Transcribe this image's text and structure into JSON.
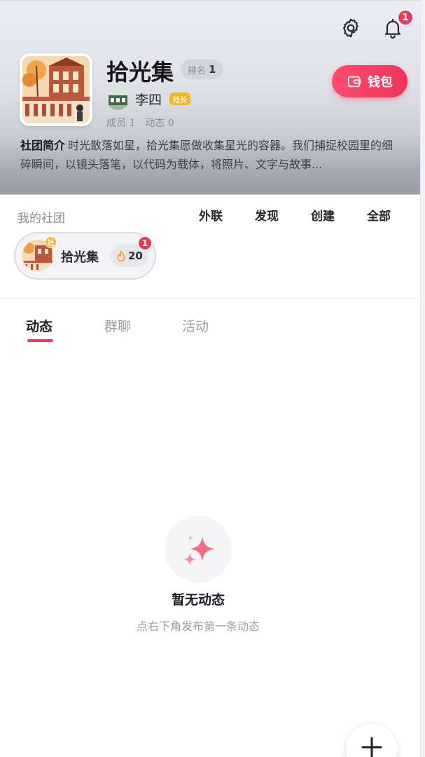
{
  "header": {
    "notification_count": "1",
    "club_name": "拾光集",
    "rank_label": "排名",
    "rank_value": "1",
    "owner_name": "李四",
    "owner_role": "社长",
    "members_label": "成员 1",
    "posts_label": "动态 0",
    "wallet_label": "钱包",
    "intro_label": "社团简介",
    "intro_text": "时光散落如星，拾光集愿做收集星光的容器。我们捕捉校园里的细碎瞬间，以镜头落笔，以代码为载体，将照片、文字与故事..."
  },
  "my_clubs": {
    "title": "我的社团",
    "nav": [
      "外联",
      "发现",
      "创建",
      "全部"
    ],
    "items": [
      {
        "avatar_badge": "社",
        "name": "拾光集",
        "heat": "20",
        "unread": "1"
      }
    ]
  },
  "tabs": [
    "动态",
    "群聊",
    "活动"
  ],
  "active_tab": "动态",
  "empty_state": {
    "title": "暂无动态",
    "subtitle": "点右下角发布第一条动态"
  },
  "colors": {
    "accent": "#f0395a",
    "role_badge": "#f6b626",
    "muted_text": "#9b9da5"
  },
  "icons": [
    "gear-icon",
    "bell-icon",
    "wallet-icon",
    "flame-icon",
    "sparkle-icon",
    "plus-icon"
  ]
}
